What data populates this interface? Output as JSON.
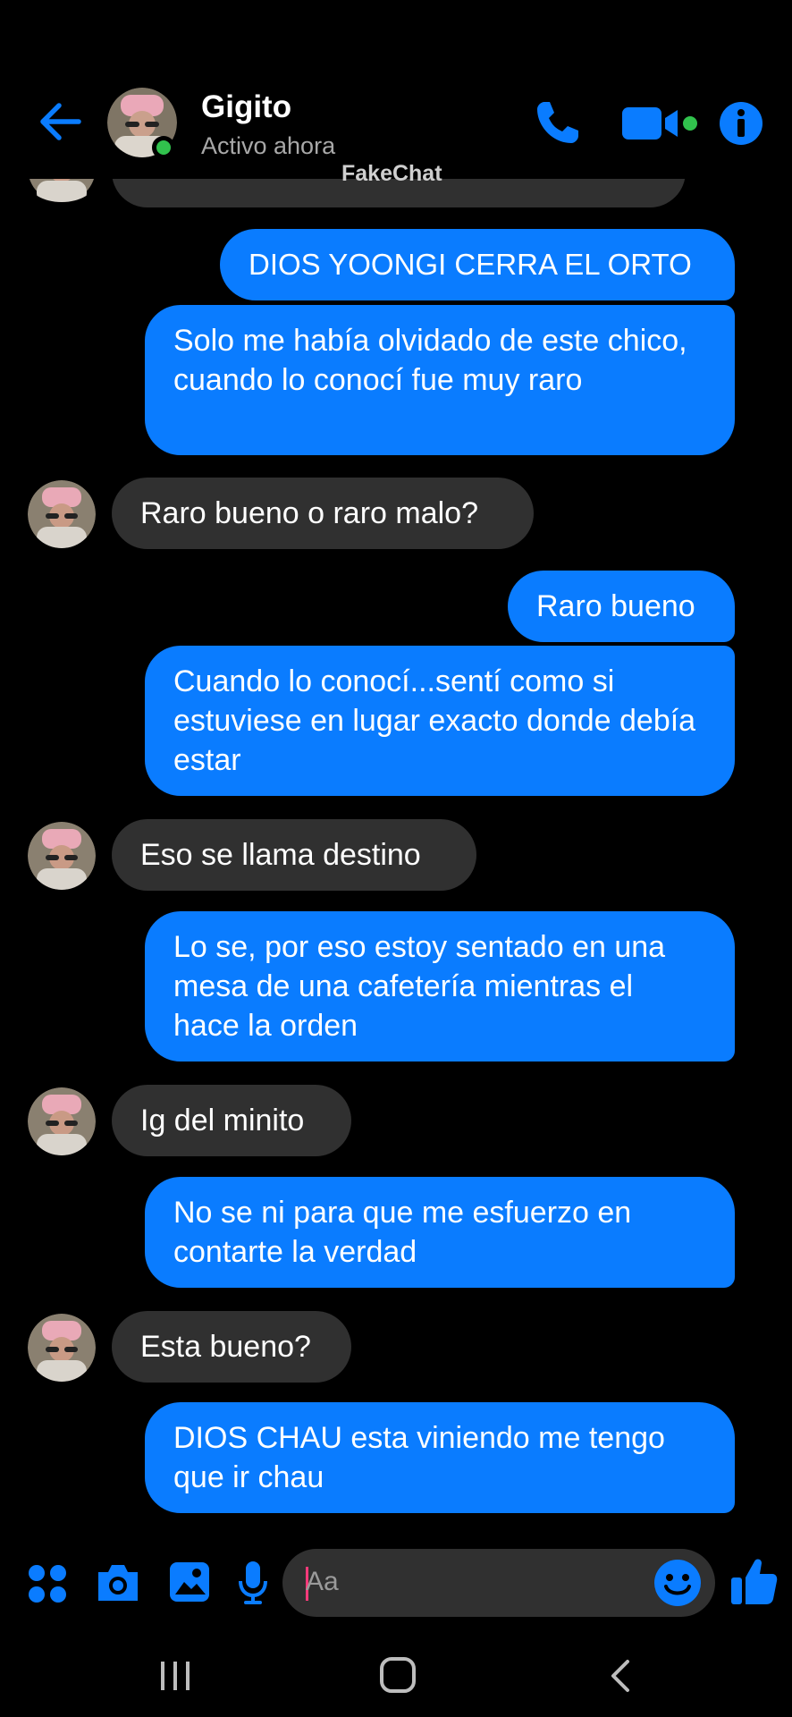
{
  "header": {
    "contact_name": "Gigito",
    "status": "Activo ahora",
    "watermark": "FakeChat"
  },
  "messages": [
    {
      "from": "me",
      "text": "DIOS YOONGI CERRA EL ORTO"
    },
    {
      "from": "me",
      "text": "Solo me había olvidado de este chico, cuando lo conocí fue muy raro"
    },
    {
      "from": "them",
      "text": "Raro bueno o raro malo?"
    },
    {
      "from": "me",
      "text": "Raro bueno"
    },
    {
      "from": "me",
      "text": "Cuando lo conocí...sentí como si estuviese en lugar exacto donde debía estar"
    },
    {
      "from": "them",
      "text": "Eso se llama destino"
    },
    {
      "from": "me",
      "text": "Lo se, por eso estoy sentado en una mesa de una cafetería mientras el hace la orden"
    },
    {
      "from": "them",
      "text": "Ig del minito"
    },
    {
      "from": "me",
      "text": "No se ni para que me esfuerzo en contarte la verdad"
    },
    {
      "from": "them",
      "text": "Esta bueno?"
    },
    {
      "from": "me",
      "text": "DIOS CHAU esta viniendo me tengo que ir chau"
    }
  ],
  "composer": {
    "placeholder": "Aa"
  },
  "colors": {
    "my_bubble": "#0a7cff",
    "their_bubble": "#303030",
    "accent": "#0a7cff",
    "online": "#31c24d"
  }
}
